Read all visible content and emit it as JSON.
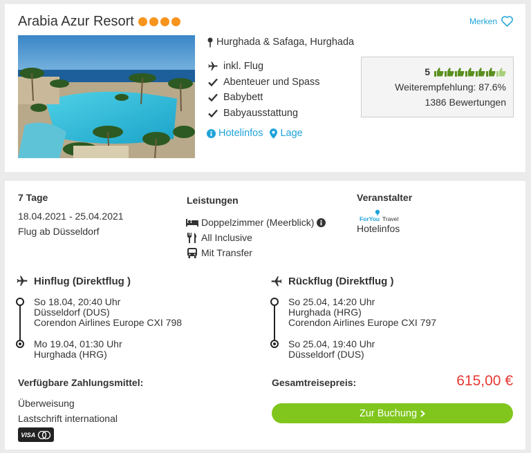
{
  "hotel": {
    "name": "Arabia Azur Resort",
    "stars": 4,
    "merken_label": "Merken",
    "location": "Hurghada & Safaga, Hurghada",
    "features": [
      {
        "icon": "plane-icon",
        "label": "inkl. Flug"
      },
      {
        "icon": "check-icon",
        "label": "Abenteuer und Spass"
      },
      {
        "icon": "check-icon",
        "label": "Babybett"
      },
      {
        "icon": "check-icon",
        "label": "Babyausstattung"
      }
    ],
    "links": {
      "hotelinfos": "Hotelinfos",
      "lage": "Lage"
    },
    "rating": {
      "score": "5",
      "thumbs_filled": 6,
      "thumbs_total": 7,
      "recommendation": "Weiterempfehlung: 87.6%",
      "reviews": "1386 Bewertungen"
    }
  },
  "trip": {
    "duration": "7 Tage",
    "dates": "18.04.2021 - 25.04.2021",
    "departure": "Flug ab Düsseldorf",
    "leistungen_title": "Leistungen",
    "leistungen": [
      {
        "icon": "bed-icon",
        "label": "Doppelzimmer (Meerblick)"
      },
      {
        "icon": "cutlery-icon",
        "label": "All Inclusive"
      },
      {
        "icon": "bus-icon",
        "label": "Mit Transfer"
      }
    ],
    "veranstalter_title": "Veranstalter",
    "veranstalter_logo": "ForYouTravel",
    "veranstalter_link": "Hotelinfos"
  },
  "outbound": {
    "title": "Hinflug (Direktflug )",
    "dep_time": "So 18.04, 20:40 Uhr",
    "dep_airport": "Düsseldorf (DUS)",
    "airline": "Corendon Airlines Europe CXI 798",
    "arr_time": "Mo 19.04, 01:30 Uhr",
    "arr_airport": "Hurghada (HRG)"
  },
  "return": {
    "title": "Rückflug (Direktflug )",
    "dep_time": "So 25.04, 14:20 Uhr",
    "dep_airport": "Hurghada (HRG)",
    "airline": "Corendon Airlines Europe CXI 797",
    "arr_time": "So 25.04, 19:40 Uhr",
    "arr_airport": "Düsseldorf (DUS)"
  },
  "payment": {
    "title": "Verfügbare Zahlungsmittel:",
    "methods": [
      "Überweisung",
      "Lastschrift international"
    ],
    "card_label": "VISA"
  },
  "booking": {
    "total_label": "Gesamtreisepreis:",
    "price": "615,00 €",
    "button_label": "Zur Buchung"
  },
  "colors": {
    "accent": "#1ea3d9",
    "star": "#f7941d",
    "price": "#e53935",
    "button": "#80c61d"
  }
}
